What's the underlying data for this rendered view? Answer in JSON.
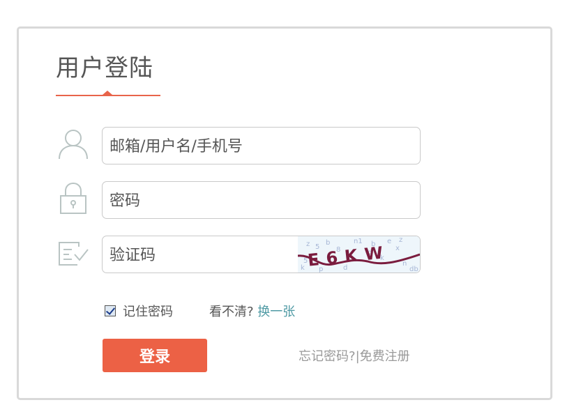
{
  "header": {
    "title": "用户登陆"
  },
  "form": {
    "username_placeholder": "邮箱/用户名/手机号",
    "password_placeholder": "密码",
    "captcha_placeholder": "验证码",
    "captcha_text": "E6KW"
  },
  "options": {
    "remember_label": "记住密码",
    "remember_checked": true,
    "unclear_text": "看不清?",
    "refresh_link": "换一张"
  },
  "actions": {
    "login_label": "登录",
    "forgot_link": "忘记密码?",
    "separator": "|",
    "register_link": "免费注册"
  },
  "colors": {
    "accent": "#ec6145",
    "link": "#4f9aa4",
    "icon": "#b9c4c3"
  }
}
